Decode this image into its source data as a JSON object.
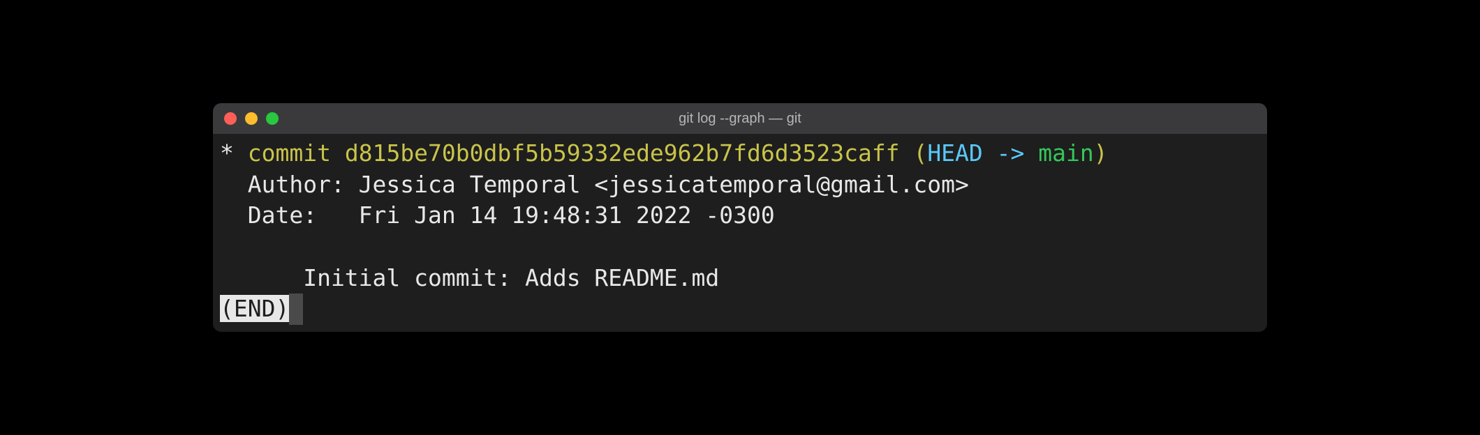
{
  "window": {
    "title": "git log --graph — git"
  },
  "log": {
    "graph_marker": "*",
    "commit_label": "commit",
    "hash": "d815be70b0dbf5b59332ede962b7fd6d3523caff",
    "paren_open": "(",
    "head": "HEAD",
    "arrow": " -> ",
    "branch": "main",
    "paren_close": ")",
    "author_line": "  Author: Jessica Temporal <jessicatemporal@gmail.com>",
    "date_line": "  Date:   Fri Jan 14 19:48:31 2022 -0300",
    "message_line": "      Initial commit: Adds README.md",
    "end_marker": "(END)"
  }
}
